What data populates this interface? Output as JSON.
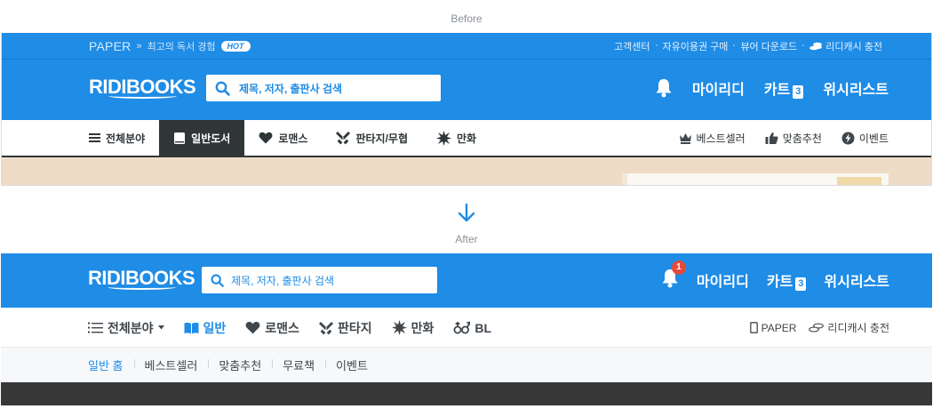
{
  "captions": {
    "before": "Before",
    "after": "After"
  },
  "before": {
    "topbar": {
      "brand": "PAPER",
      "chevron": "»",
      "tagline": "최고의 독서 경험",
      "hot": "HOT",
      "links": [
        "고객센터",
        "자유이용권 구매",
        "뷰어 다운로드"
      ],
      "cash": "리디캐시 충전"
    },
    "header": {
      "logo": "RIDIBOOKS",
      "search_placeholder": "제목, 저자, 출판사 검색",
      "my": "마이리디",
      "cart": "카트",
      "cart_count": "3",
      "wishlist": "위시리스트"
    },
    "nav": {
      "tabs": [
        {
          "label": "전체분야",
          "icon": "hamburger-icon"
        },
        {
          "label": "일반도서",
          "icon": "book-icon"
        },
        {
          "label": "로맨스",
          "icon": "heart-icon"
        },
        {
          "label": "판타지/무협",
          "icon": "swords-icon"
        },
        {
          "label": "만화",
          "icon": "burst-icon"
        }
      ],
      "active_tab": "일반도서",
      "right": [
        {
          "label": "베스트셀러",
          "icon": "crown-icon"
        },
        {
          "label": "맞춤추천",
          "icon": "thumbs-up-icon"
        },
        {
          "label": "이벤트",
          "icon": "lightning-icon"
        }
      ]
    }
  },
  "after": {
    "header": {
      "logo": "RIDIBOOKS",
      "search_placeholder": "제목, 저자, 출판사 검색",
      "notification_count": "1",
      "my": "마이리디",
      "cart": "카트",
      "cart_count": "3",
      "wishlist": "위시리스트"
    },
    "nav": {
      "tabs": [
        {
          "label": "전체분야",
          "icon": "list-icon"
        },
        {
          "label": "일반",
          "icon": "open-book-icon"
        },
        {
          "label": "로맨스",
          "icon": "heart-icon"
        },
        {
          "label": "판타지",
          "icon": "swords-icon"
        },
        {
          "label": "만화",
          "icon": "burst-icon"
        },
        {
          "label": "BL",
          "icon": "gender-icon"
        }
      ],
      "active_tab": "일반",
      "right": [
        {
          "label": "PAPER",
          "icon": "device-icon"
        },
        {
          "label": "리디캐시 충전",
          "icon": "coins-icon"
        }
      ]
    },
    "subnav": [
      "일반 홈",
      "베스트셀러",
      "맞춤추천",
      "무료책",
      "이벤트"
    ],
    "subnav_active": "일반 홈"
  },
  "colors": {
    "brand_blue": "#1f8ce6",
    "dark": "#303538",
    "notification_red": "#e64938"
  }
}
